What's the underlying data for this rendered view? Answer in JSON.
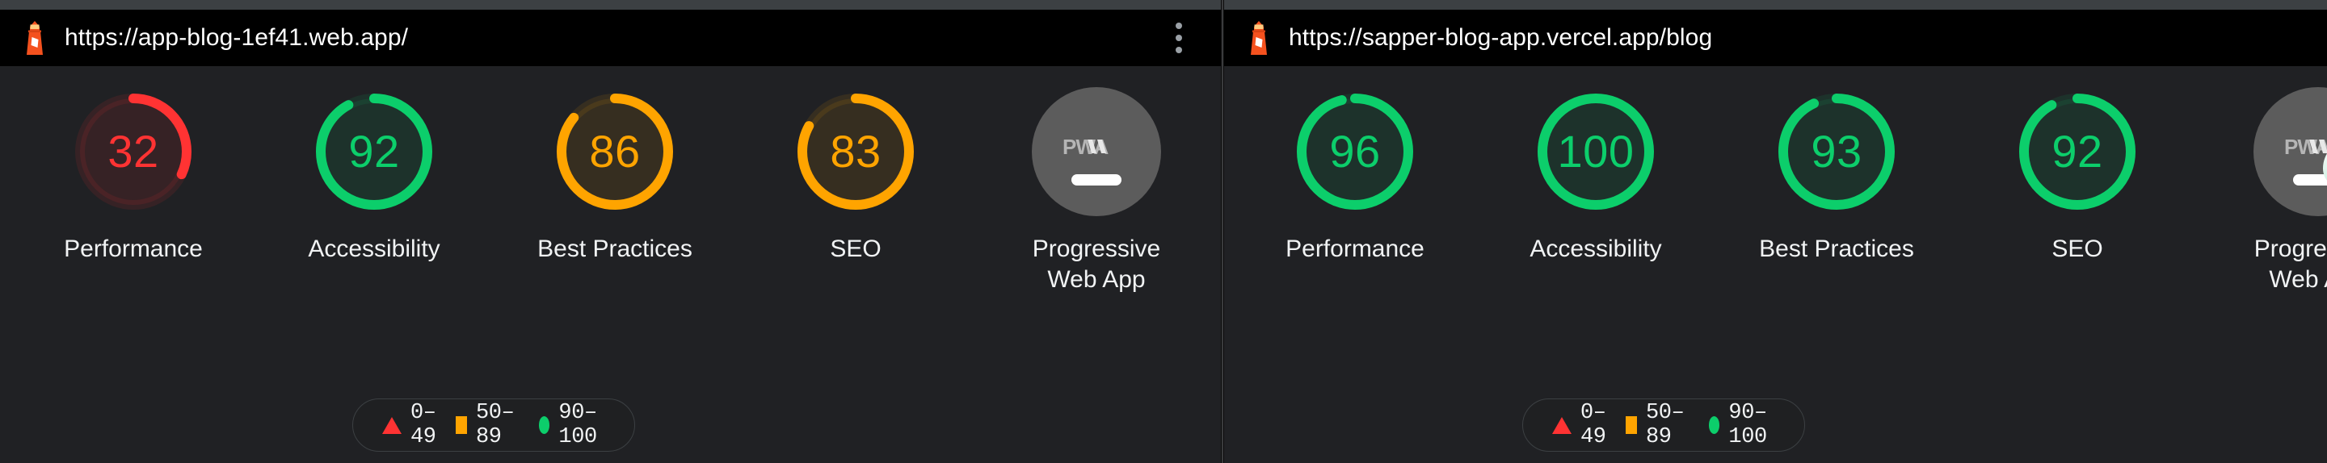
{
  "theme": {
    "background": "#202124",
    "urlbar_background": "#000000",
    "topstrip": "#3c4043",
    "text": "#f1f3f4",
    "fail_color": "#f33",
    "average_color": "#ffa400",
    "pass_color": "#0cce6b",
    "pwa_circle": "#5c5c5c"
  },
  "reports": [
    {
      "id": "report-left",
      "icon": "lighthouse-icon",
      "url": "https://app-blog-1ef41.web.app/",
      "menu_icon": "kebab-menu-icon",
      "has_menu": true,
      "categories": [
        {
          "label": "Performance",
          "score": "32",
          "value": 32,
          "color": "#f33",
          "rating": "fail"
        },
        {
          "label": "Accessibility",
          "score": "92",
          "value": 92,
          "color": "#0cce6b",
          "rating": "pass"
        },
        {
          "label": "Best Practices",
          "score": "86",
          "value": 86,
          "color": "#ffa400",
          "rating": "average"
        },
        {
          "label": "SEO",
          "score": "83",
          "value": 83,
          "color": "#ffa400",
          "rating": "average"
        }
      ],
      "pwa": {
        "label": "Progressive\nWeb App",
        "badge_text": "PWA",
        "icon": "pwa-badge-icon",
        "state": "not-installable",
        "show_install_cursor": false
      },
      "legend": [
        {
          "icon": "triangle-swatch",
          "text": "0–49"
        },
        {
          "icon": "square-swatch",
          "text": "50–89"
        },
        {
          "icon": "circle-swatch",
          "text": "90–100"
        }
      ]
    },
    {
      "id": "report-right",
      "icon": "lighthouse-icon",
      "url": "https://sapper-blog-app.vercel.app/blog",
      "menu_icon": "kebab-menu-icon",
      "has_menu": false,
      "categories": [
        {
          "label": "Performance",
          "score": "96",
          "value": 96,
          "color": "#0cce6b",
          "rating": "pass"
        },
        {
          "label": "Accessibility",
          "score": "100",
          "value": 100,
          "color": "#0cce6b",
          "rating": "pass"
        },
        {
          "label": "Best Practices",
          "score": "93",
          "value": 93,
          "color": "#0cce6b",
          "rating": "pass"
        },
        {
          "label": "SEO",
          "score": "92",
          "value": 92,
          "color": "#0cce6b",
          "rating": "pass"
        }
      ],
      "pwa": {
        "label": "Progressive\nWeb App",
        "badge_text": "PWA",
        "icon": "pwa-badge-icon",
        "state": "installable",
        "show_install_cursor": true
      },
      "legend": [
        {
          "icon": "triangle-swatch",
          "text": "0–49"
        },
        {
          "icon": "square-swatch",
          "text": "50–89"
        },
        {
          "icon": "circle-swatch",
          "text": "90–100"
        }
      ]
    }
  ]
}
